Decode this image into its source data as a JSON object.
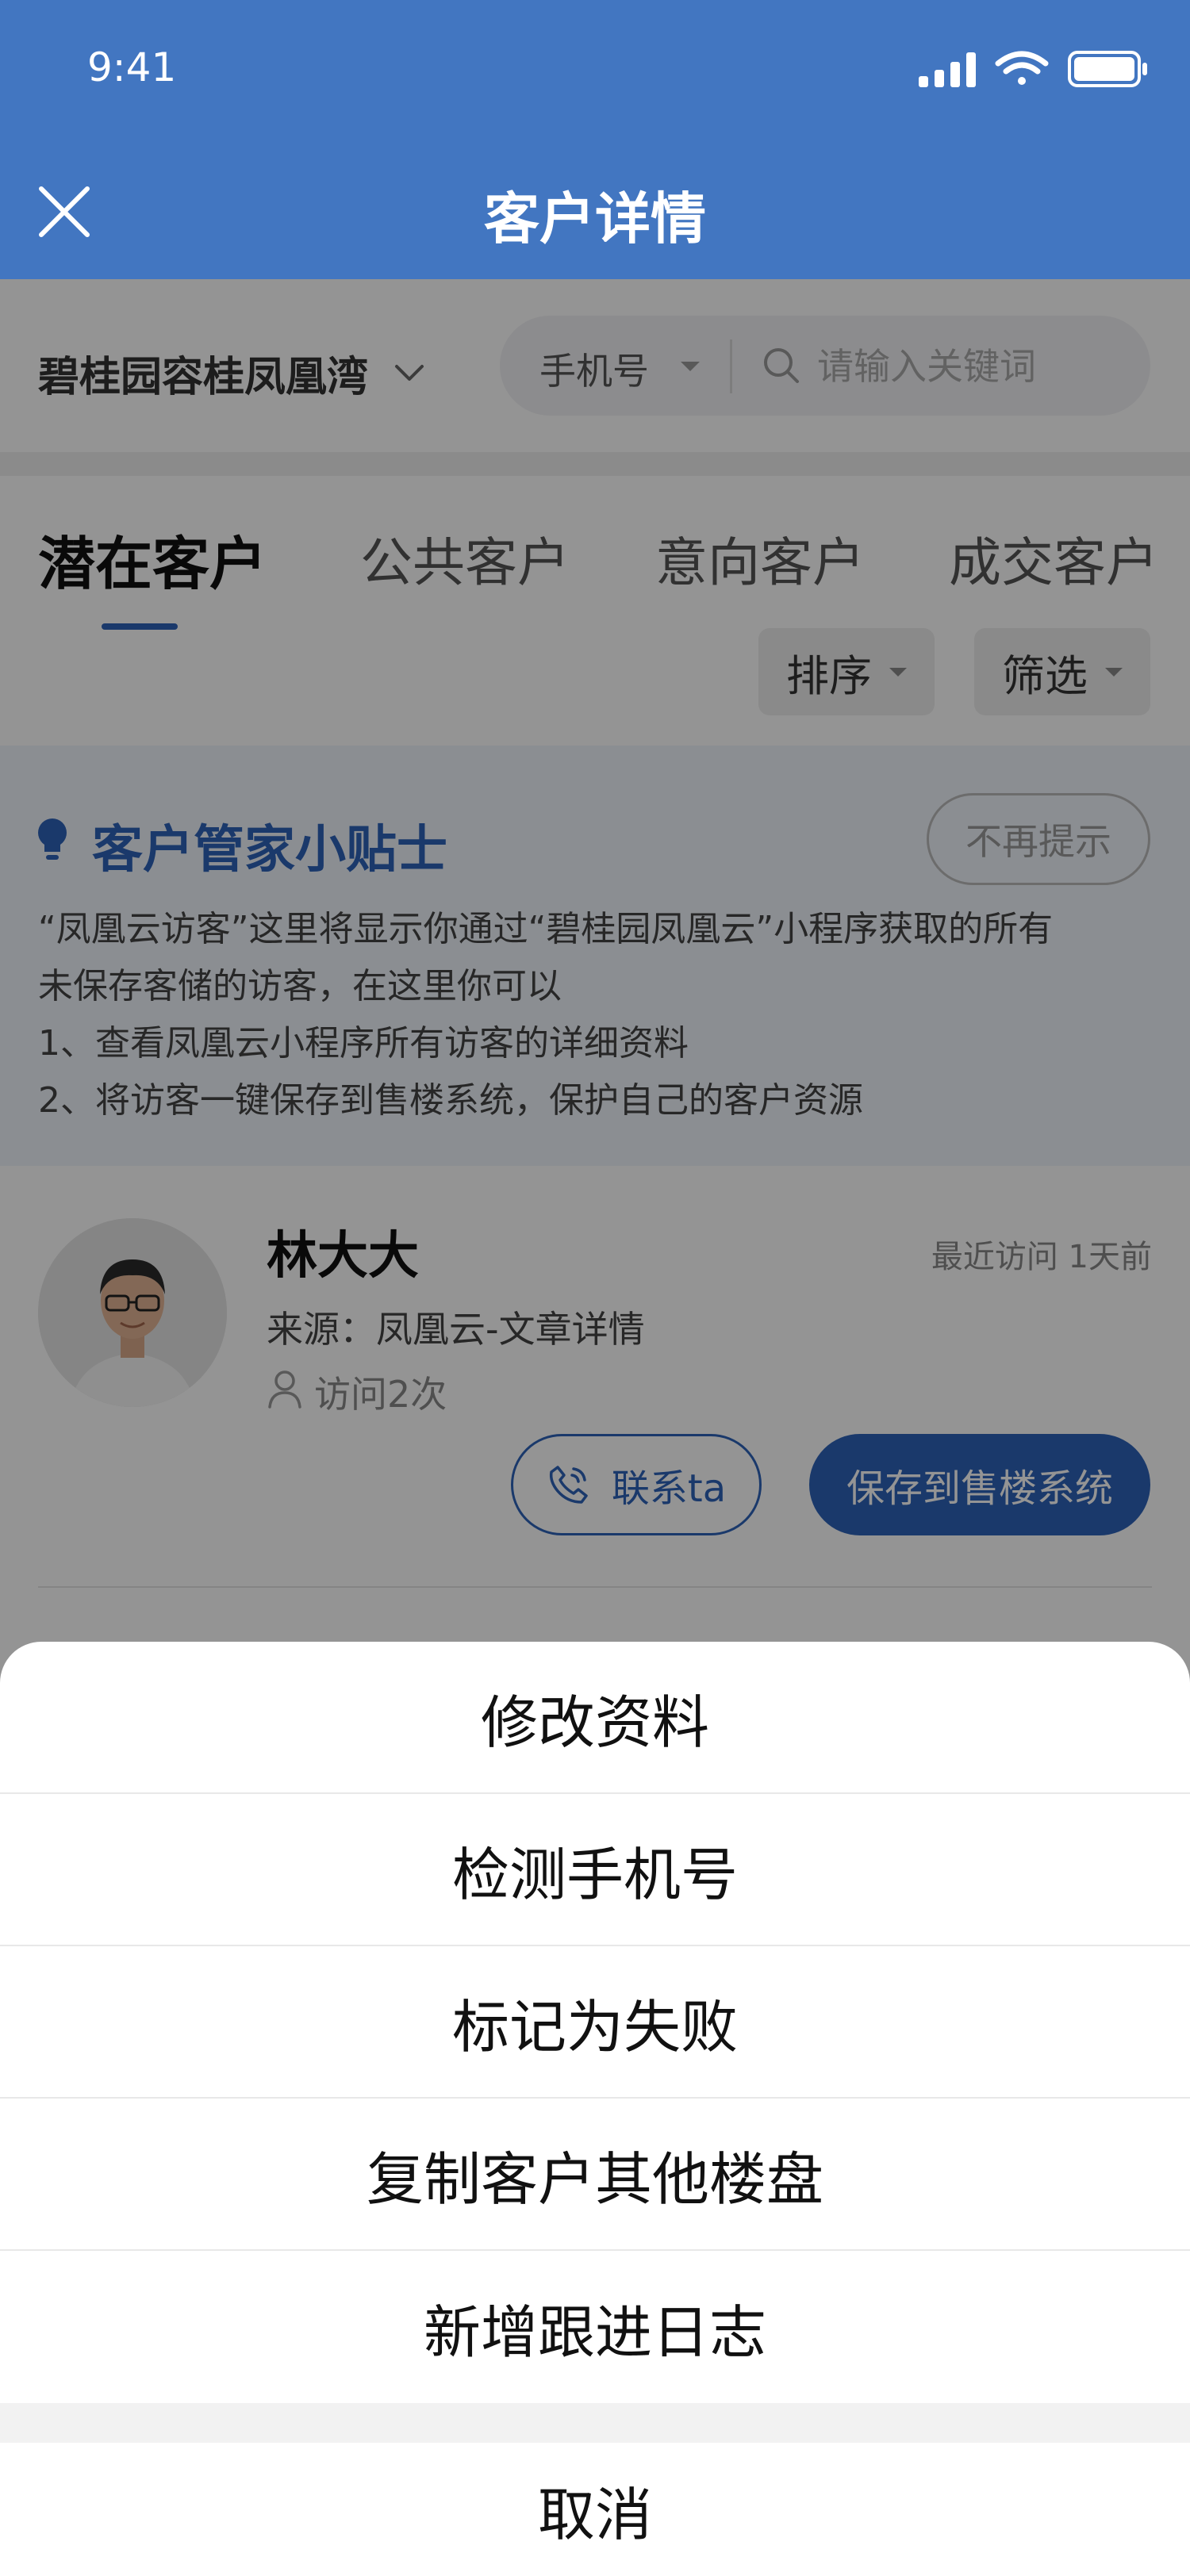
{
  "status_bar": {
    "time": "9:41"
  },
  "nav": {
    "title": "客户详情"
  },
  "filter": {
    "project": "碧桂园容桂凤凰湾",
    "search_type": "手机号",
    "search_placeholder": "请输入关键词"
  },
  "tabs": [
    "潜在客户",
    "公共客户",
    "意向客户",
    "成交客户"
  ],
  "toolbar": {
    "sort": "排序",
    "filter": "筛选"
  },
  "tips": {
    "title": "客户管家小贴士",
    "dismiss": "不再提示",
    "lines": [
      "“凤凰云访客”这里将显示你通过“碧桂园凤凰云”小程序获取的所有",
      "未保存客储的访客，在这里你可以",
      "1、查看凤凰云小程序所有访客的详细资料",
      "2、将访客一键保存到售楼系统，保护自己的客户资源"
    ]
  },
  "customer": {
    "name": "林大大",
    "last_visit": "最近访问 1天前",
    "source": "来源：凤凰云-文章详情",
    "visits": "访问2次",
    "contact_label": "联系ta",
    "save_label": "保存到售楼系统"
  },
  "action_sheet": {
    "items": [
      "修改资料",
      "检测手机号",
      "标记为失败",
      "复制客户其他楼盘",
      "新增跟进日志"
    ],
    "cancel": "取消"
  },
  "colors": {
    "brand_blue": "#4276c1",
    "accent_blue": "#2d62b8",
    "mask": "rgba(0,0,0,0.42)"
  }
}
